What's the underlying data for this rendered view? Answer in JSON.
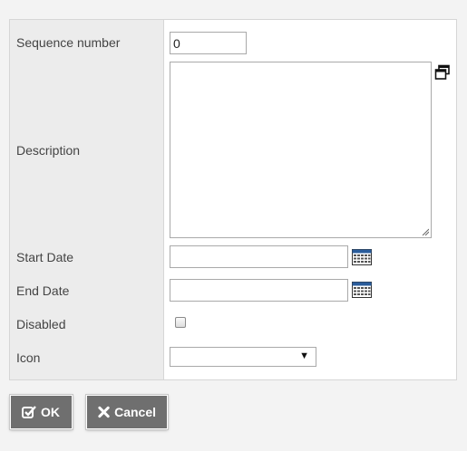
{
  "form": {
    "sequence_label": "Sequence number",
    "sequence_value": "0",
    "description_label": "Description",
    "description_value": "",
    "start_date_label": "Start Date",
    "start_date_value": "",
    "end_date_label": "End Date",
    "end_date_value": "",
    "disabled_label": "Disabled",
    "disabled_checked": false,
    "icon_label": "Icon",
    "icon_value": ""
  },
  "buttons": {
    "ok_label": "OK",
    "cancel_label": "Cancel"
  },
  "icons": {
    "popout": "popout-window-icon",
    "calendar": "calendar-icon",
    "ok": "checkbox-check-icon",
    "cancel": "x-cross-icon",
    "dropdown": "triangle-down-icon"
  },
  "colors": {
    "button_bg": "#6f6f6f",
    "label_column_bg": "#ececec",
    "calendar_header": "#2a5d9c"
  }
}
